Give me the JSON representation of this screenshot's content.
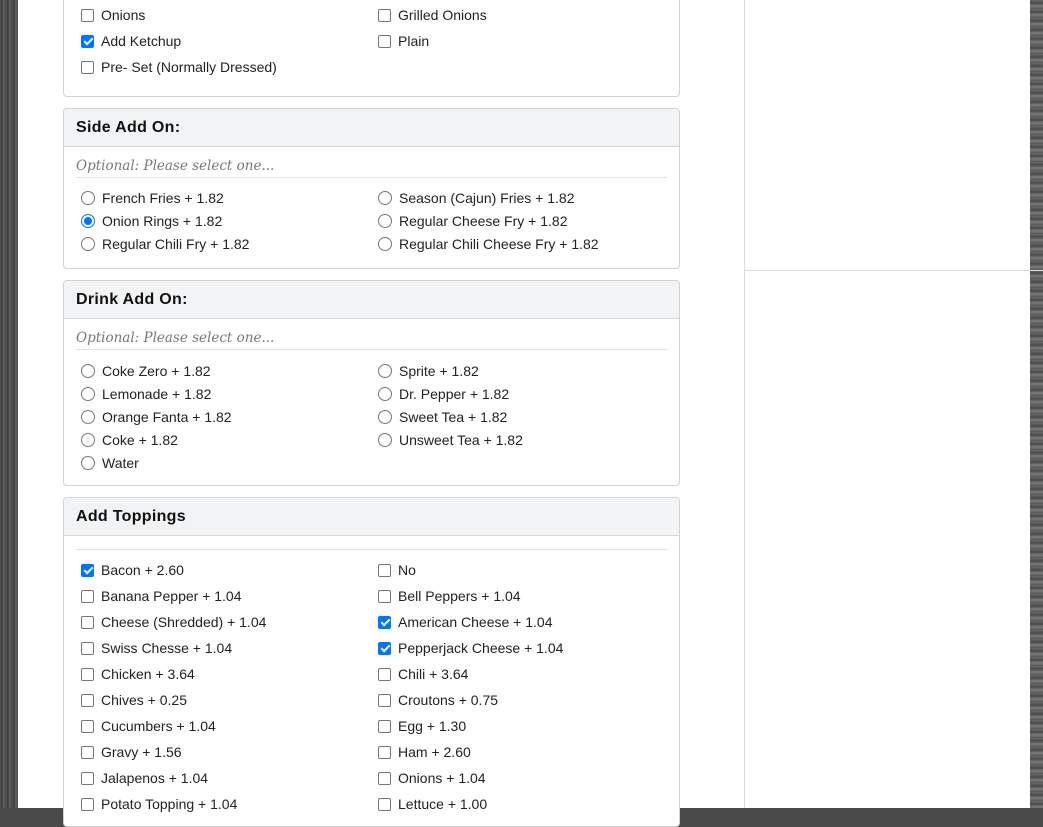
{
  "colors": {
    "accent": "#0075ff",
    "panel_header_bg": "#f2f3f4",
    "border": "#d3d3d3"
  },
  "dressing": {
    "options": [
      {
        "label": "Onions",
        "checked": false
      },
      {
        "label": "Grilled Onions",
        "checked": false
      },
      {
        "label": "Add Ketchup",
        "checked": true
      },
      {
        "label": "Plain",
        "checked": false
      },
      {
        "label": "Pre- Set (Normally Dressed)",
        "checked": false
      }
    ]
  },
  "side_add_on": {
    "title": "Side Add On:",
    "hint": "Optional: Please select one...",
    "options": [
      {
        "label": "French Fries + 1.82",
        "selected": false
      },
      {
        "label": "Season (Cajun) Fries + 1.82",
        "selected": false
      },
      {
        "label": "Onion Rings + 1.82",
        "selected": true
      },
      {
        "label": "Regular Cheese Fry + 1.82",
        "selected": false
      },
      {
        "label": "Regular Chili Fry + 1.82",
        "selected": false
      },
      {
        "label": "Regular Chili Cheese Fry + 1.82",
        "selected": false
      }
    ]
  },
  "drink_add_on": {
    "title": "Drink Add On:",
    "hint": "Optional: Please select one...",
    "options": [
      {
        "label": "Coke Zero + 1.82",
        "selected": false
      },
      {
        "label": "Sprite + 1.82",
        "selected": false
      },
      {
        "label": "Lemonade + 1.82",
        "selected": false
      },
      {
        "label": "Dr. Pepper + 1.82",
        "selected": false
      },
      {
        "label": "Orange Fanta + 1.82",
        "selected": false
      },
      {
        "label": "Sweet Tea + 1.82",
        "selected": false
      },
      {
        "label": "Coke + 1.82",
        "selected": false
      },
      {
        "label": "Unsweet Tea + 1.82",
        "selected": false
      },
      {
        "label": "Water",
        "selected": false
      }
    ]
  },
  "toppings": {
    "title": "Add Toppings",
    "options": [
      {
        "label": "Bacon + 2.60",
        "checked": true
      },
      {
        "label": "No",
        "checked": false
      },
      {
        "label": "Banana Pepper + 1.04",
        "checked": false
      },
      {
        "label": "Bell Peppers + 1.04",
        "checked": false
      },
      {
        "label": "Cheese (Shredded) + 1.04",
        "checked": false
      },
      {
        "label": "American Cheese + 1.04",
        "checked": true
      },
      {
        "label": "Swiss Chesse + 1.04",
        "checked": false
      },
      {
        "label": "Pepperjack Cheese + 1.04",
        "checked": true
      },
      {
        "label": "Chicken + 3.64",
        "checked": false
      },
      {
        "label": "Chili + 3.64",
        "checked": false
      },
      {
        "label": "Chives + 0.25",
        "checked": false
      },
      {
        "label": "Croutons + 0.75",
        "checked": false
      },
      {
        "label": "Cucumbers + 1.04",
        "checked": false
      },
      {
        "label": "Egg + 1.30",
        "checked": false
      },
      {
        "label": "Gravy + 1.56",
        "checked": false
      },
      {
        "label": "Ham + 2.60",
        "checked": false
      },
      {
        "label": "Jalapenos + 1.04",
        "checked": false
      },
      {
        "label": "Onions + 1.04",
        "checked": false
      },
      {
        "label": "Potato Topping + 1.04",
        "checked": false
      },
      {
        "label": "Lettuce + 1.00",
        "checked": false
      }
    ]
  }
}
